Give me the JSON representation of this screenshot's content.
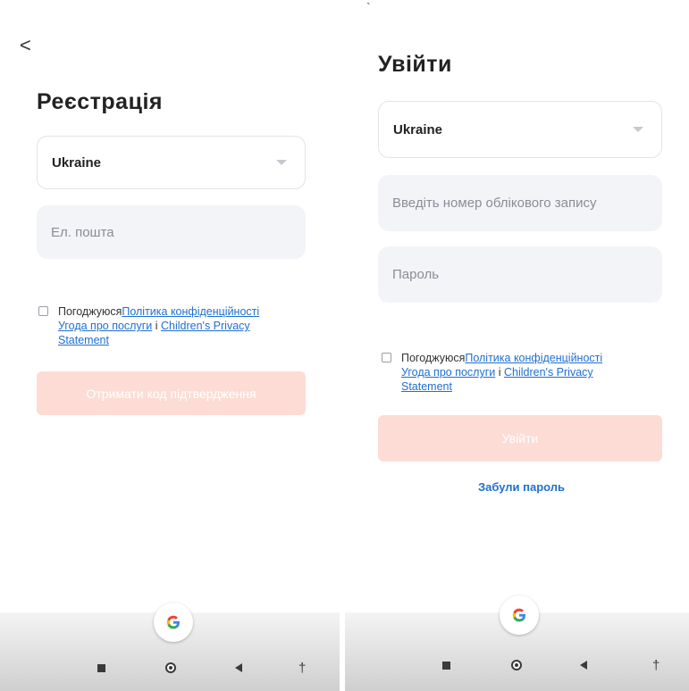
{
  "register": {
    "back": "<",
    "title": "Реєстрація",
    "country": "Ukraine",
    "email_placeholder": "Ел. пошта",
    "agree_prefix": "Погоджуюся",
    "privacy_link": "Політика конфіденційності",
    "terms_link": "Угода про послуги",
    "conj": " і ",
    "children_link_a": "Children's Privacy",
    "children_link_b": "Statement",
    "submit": "Отримати код підтвердження"
  },
  "login": {
    "mark": "`",
    "title": "Увійти",
    "country": "Ukraine",
    "account_placeholder": "Введіть номер облікового запису",
    "password_placeholder": "Пароль",
    "agree_prefix": "Погоджуюся",
    "privacy_link": "Політика конфіденційності",
    "terms_link": "Угода про послуги",
    "conj": " і ",
    "children_link_a": "Children's Privacy",
    "children_link_b": "Statement",
    "submit": "Увійти",
    "forgot": "Забули пароль"
  },
  "google_label": "G",
  "nav": {
    "accessibility_glyph": "†"
  },
  "colors": {
    "accent_link": "#1f6fd1",
    "primary_disabled": "#fddcd5",
    "field_bg": "#f3f4f8"
  }
}
